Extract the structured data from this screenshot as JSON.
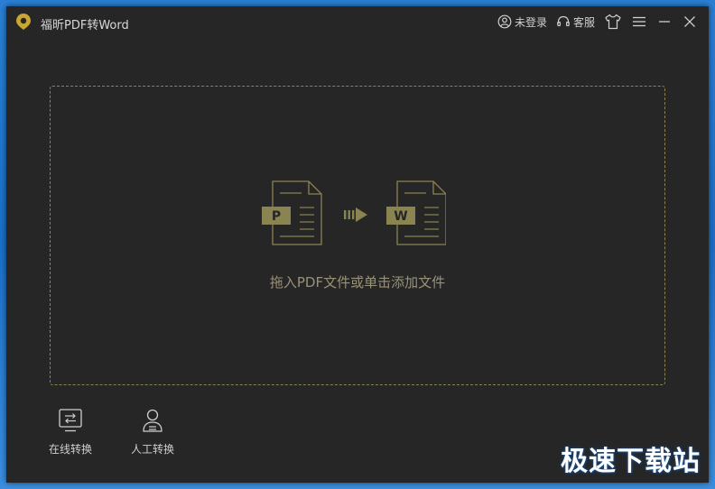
{
  "app": {
    "title": "福昕PDF转Word"
  },
  "titlebar": {
    "login_label": "未登录",
    "service_label": "客服"
  },
  "dropzone": {
    "text": "拖入PDF文件或单击添加文件",
    "pdf_letter": "P",
    "word_letter": "W"
  },
  "tools": [
    {
      "label": "在线转换"
    },
    {
      "label": "人工转换"
    }
  ],
  "watermark": "极速下载站",
  "colors": {
    "accent": "#8a8352",
    "background": "#262626"
  }
}
